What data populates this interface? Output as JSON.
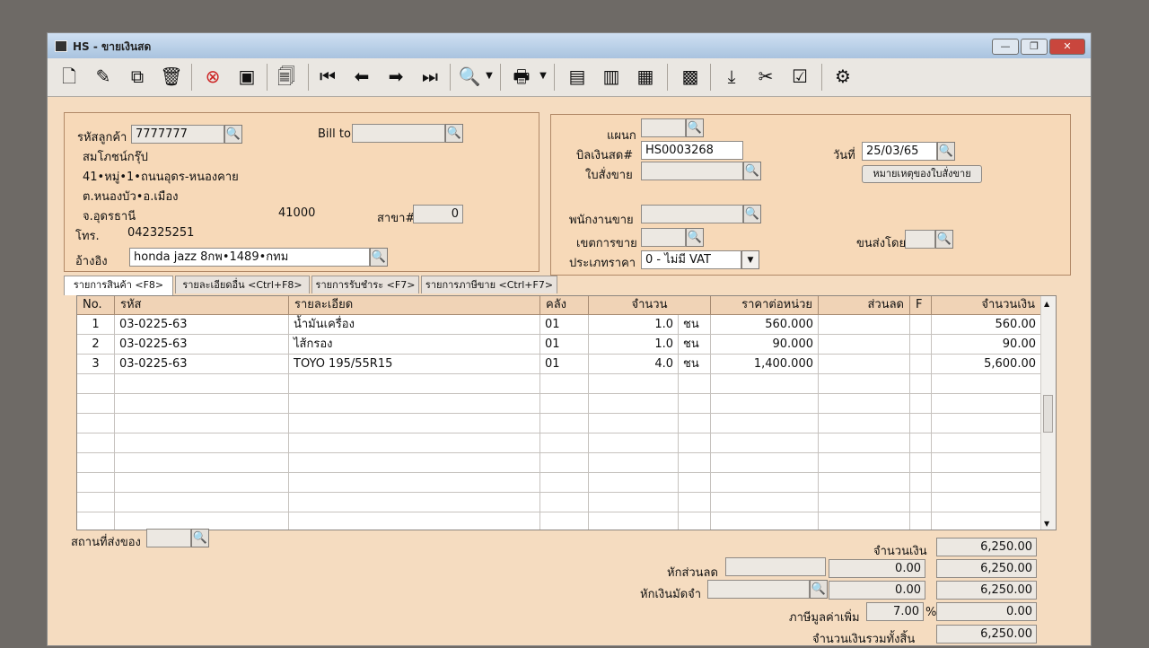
{
  "window": {
    "title": "HS - ขายเงินสด"
  },
  "toolbar": {
    "icons": [
      "new-icon",
      "edit-icon",
      "copy-icon",
      "delete-icon",
      "cancel-icon",
      "save-icon",
      "print-doc-icon",
      "first-icon",
      "prev-icon",
      "next-icon",
      "last-icon",
      "search-icon",
      "printer-icon",
      "report1-icon",
      "report2-icon",
      "report3-icon",
      "calc-icon",
      "import-icon",
      "tool-icon",
      "approve-icon",
      "settings-icon"
    ]
  },
  "customer": {
    "code_label": "รหัสลูกค้า",
    "code": "7777777",
    "name": "สมโภชน์กรุ๊ป",
    "address1": "41•หมู่•1•ถนนอุดร-หนองคาย",
    "address2": "ต.หนองบัว•อ.เมือง",
    "province": "จ.อุดรธานี",
    "zip": "41000",
    "branch_label": "สาขา#",
    "branch": "0",
    "phone_label": "โทร.",
    "phone": "042325251",
    "ref_label": "อ้างอิง",
    "ref": "honda jazz 8กพ•1489•กทม",
    "billto_label": "Bill to",
    "billto": ""
  },
  "doc": {
    "dept_label": "แผนก",
    "dept": "",
    "bill_label": "บิลเงินสด#",
    "bill": "HS0003268",
    "order_label": "ใบสั่งขาย",
    "order": "",
    "date_label": "วันที่",
    "date": "25/03/65",
    "order_note_button": "หมายเหตุของใบสั่งขาย",
    "salesman_label": "พนักงานขาย",
    "salesman": "",
    "area_label": "เขตการขาย",
    "area": "",
    "ship_label": "ขนส่งโดย",
    "ship": "",
    "pricetype_label": "ประเภทราคา",
    "pricetype": "0 - ไม่มี VAT"
  },
  "tabs": [
    "รายการสินค้า <F8>",
    "รายละเอียดอื่น <Ctrl+F8>",
    "รายการรับชำระ <F7>",
    "รายการภาษีขาย <Ctrl+F7>"
  ],
  "grid": {
    "headers": [
      "No.",
      "รหัส",
      "รายละเอียด",
      "คลัง",
      "จำนวน",
      "ราคาต่อหน่วย",
      "ส่วนลด",
      "F",
      "จำนวนเงิน"
    ],
    "rows": [
      {
        "no": "1",
        "code": "03-0225-63",
        "desc": "น้ำมันเครื่อง",
        "wh": "01",
        "qty": "1.0",
        "unit": "ชน",
        "price": "560.000",
        "disc": "",
        "f": "",
        "amount": "560.00"
      },
      {
        "no": "2",
        "code": "03-0225-63",
        "desc": "ไส้กรอง",
        "wh": "01",
        "qty": "1.0",
        "unit": "ชน",
        "price": "90.000",
        "disc": "",
        "f": "",
        "amount": "90.00"
      },
      {
        "no": "3",
        "code": "03-0225-63",
        "desc": "TOYO 195/55R15",
        "wh": "01",
        "qty": "4.0",
        "unit": "ชน",
        "price": "1,400.000",
        "disc": "",
        "f": "",
        "amount": "5,600.00"
      }
    ]
  },
  "footer": {
    "shipto_label": "สถานที่ส่งของ",
    "shipto": "",
    "total_label": "จำนวนเงิน",
    "total": "6,250.00",
    "discount_label": "หักส่วนลด",
    "discount_text": "",
    "discount_amt": "0.00",
    "after_discount": "6,250.00",
    "deposit_label": "หักเงินมัดจำ",
    "deposit_text": "",
    "deposit_amt": "0.00",
    "after_deposit": "6,250.00",
    "vat_label": "ภาษีมูลค่าเพิ่ม",
    "vat_rate": "7.00",
    "vat_pct": "%",
    "vat_amt": "0.00",
    "grand_label": "จำนวนเงินรวมทั้งสิ้น",
    "grand": "6,250.00"
  }
}
